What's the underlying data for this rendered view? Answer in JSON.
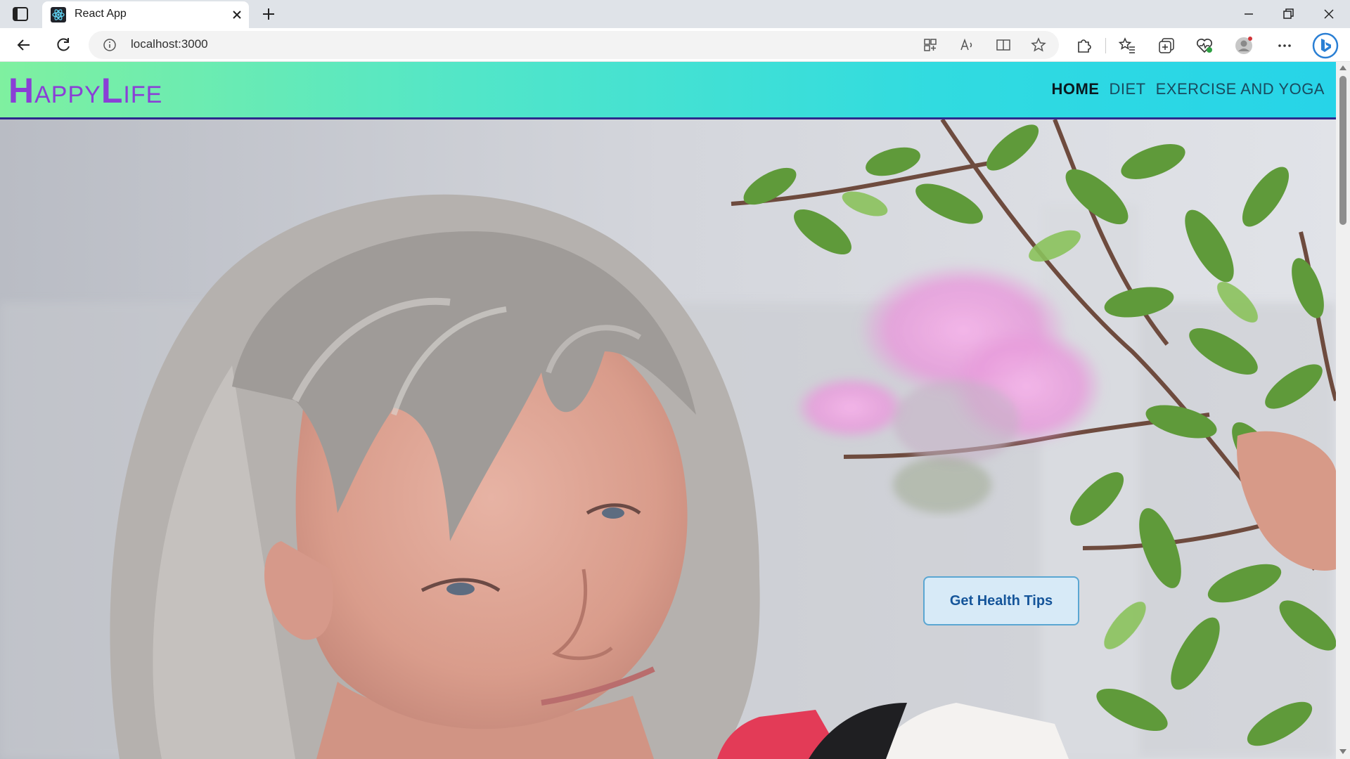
{
  "browser": {
    "tab_title": "React App",
    "url": "localhost:3000"
  },
  "site": {
    "logo": {
      "first_initial": "H",
      "first_rest": "APPY",
      "second_initial": "L",
      "second_rest": "IFE"
    },
    "nav": [
      {
        "label": "HOME",
        "active": true
      },
      {
        "label": "DIET",
        "active": false
      },
      {
        "label": "EXERCISE AND YOGA",
        "active": false
      }
    ],
    "hero": {
      "cta_label": "Get Health Tips"
    }
  },
  "colors": {
    "logo": "#8a3fd6",
    "header_gradient_start": "#7ff0a0",
    "header_gradient_end": "#27d4e8",
    "header_border": "#2c2a8c",
    "cta_bg": "#d7eaf7",
    "cta_text": "#15559a"
  },
  "icons": {
    "tab_actions": "tab-actions-icon",
    "favicon": "react-logo-icon",
    "close": "close-icon",
    "new_tab": "plus-icon",
    "back": "back-arrow-icon",
    "refresh": "refresh-icon",
    "site_info": "info-icon",
    "app_available": "app-grid-icon",
    "read_aloud": "read-aloud-icon",
    "immersive_reader": "immersive-reader-icon",
    "favorite": "star-icon",
    "extensions": "puzzle-icon",
    "favorites": "favorites-icon",
    "collections": "collections-icon",
    "browser_essentials": "heart-pulse-icon",
    "profile": "profile-icon",
    "more": "more-dots-icon",
    "copilot": "bing-icon"
  }
}
